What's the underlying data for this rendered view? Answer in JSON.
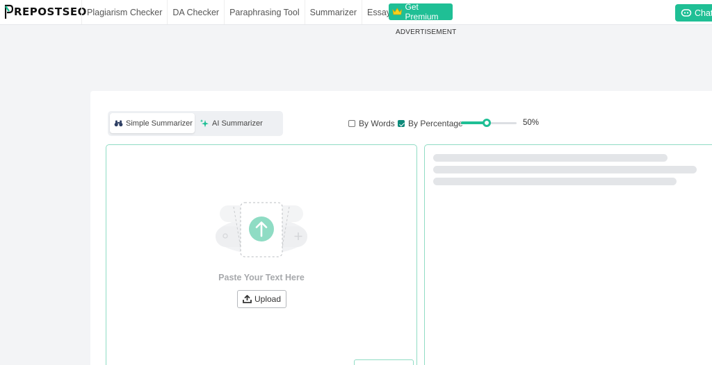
{
  "header": {
    "logo_text": "REPOSTSEO",
    "nav": [
      {
        "label": "Plagiarism Checker"
      },
      {
        "label": "DA Checker"
      },
      {
        "label": "Paraphrasing Tool"
      },
      {
        "label": "Summarizer"
      },
      {
        "label": "Essay Writer"
      }
    ],
    "premium_label": "Get Premium",
    "chat_label": "Chat"
  },
  "ad": {
    "label": "ADVERTISEMENT"
  },
  "summarizer": {
    "tabs": [
      {
        "label": "Simple Summarizer",
        "icon": "binoculars-icon",
        "active": true
      },
      {
        "label": "AI Summarizer",
        "icon": "sparkle-icon",
        "active": false
      }
    ],
    "by_words": {
      "label": "By Words",
      "checked": false
    },
    "by_percentage": {
      "label": "By Percentage",
      "checked": true
    },
    "percentage": {
      "value": 50,
      "display": "50%"
    },
    "input": {
      "prompt": "Paste Your Text Here",
      "upload_label": "Upload",
      "language_value": ""
    }
  },
  "colors": {
    "accent": "#1fbf95",
    "checkbox_checked": "#0d8a7a",
    "panel_border": "#8fdcc4",
    "skeleton": "#e3e5e8"
  }
}
